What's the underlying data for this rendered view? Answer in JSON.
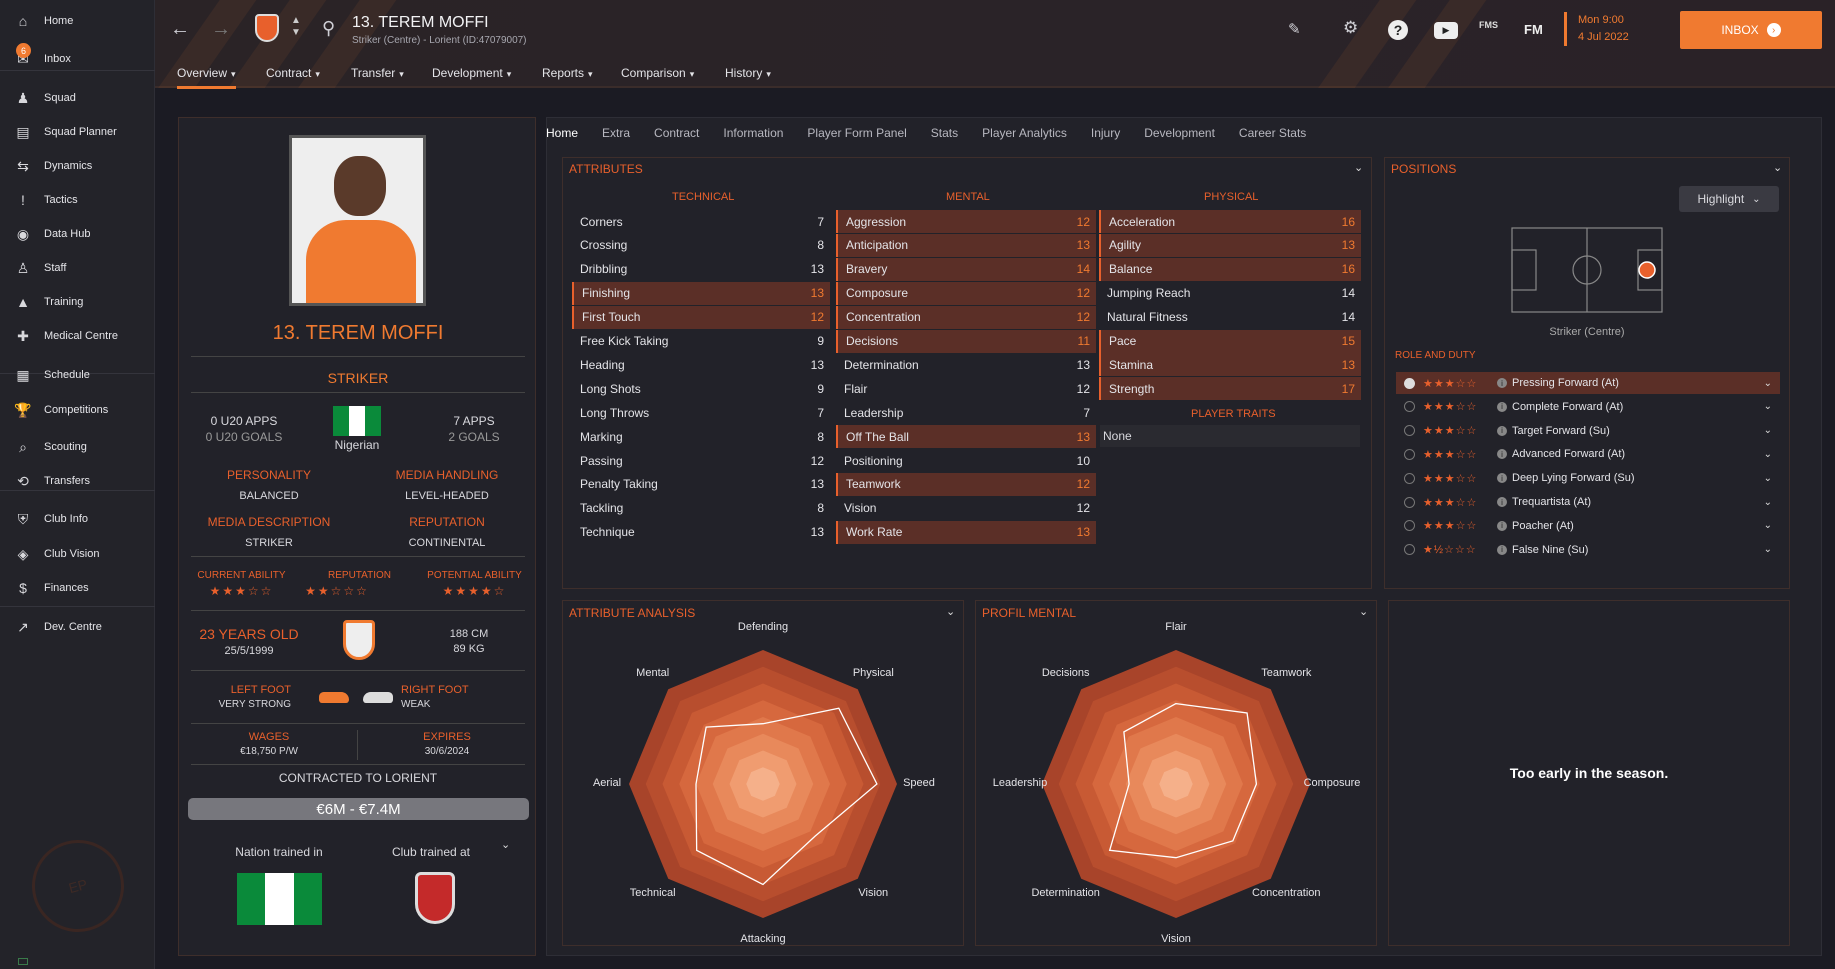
{
  "sidebar": {
    "items": [
      {
        "label": "Home",
        "icon": "home-icon"
      },
      {
        "label": "Inbox",
        "icon": "inbox-icon"
      },
      {
        "label": "Squad",
        "icon": "squad-icon"
      },
      {
        "label": "Squad Planner",
        "icon": "planner-icon"
      },
      {
        "label": "Dynamics",
        "icon": "dynamics-icon"
      },
      {
        "label": "Tactics",
        "icon": "tactics-icon"
      },
      {
        "label": "Data Hub",
        "icon": "datahub-icon"
      },
      {
        "label": "Staff",
        "icon": "staff-icon"
      },
      {
        "label": "Training",
        "icon": "training-icon"
      },
      {
        "label": "Medical Centre",
        "icon": "medical-icon"
      },
      {
        "label": "Schedule",
        "icon": "schedule-icon"
      },
      {
        "label": "Competitions",
        "icon": "trophy-icon"
      },
      {
        "label": "Scouting",
        "icon": "scouting-icon"
      },
      {
        "label": "Transfers",
        "icon": "transfers-icon"
      },
      {
        "label": "Club Info",
        "icon": "club-info-icon"
      },
      {
        "label": "Club Vision",
        "icon": "club-vision-icon"
      },
      {
        "label": "Finances",
        "icon": "finances-icon"
      },
      {
        "label": "Dev. Centre",
        "icon": "dev-centre-icon"
      }
    ],
    "inbox_badge": "6"
  },
  "header": {
    "title": "13. TEREM MOFFI",
    "subtitle": "Striker (Centre) - Lorient (ID:47079007)",
    "date_line1": "Mon 9:00",
    "date_line2": "4 Jul 2022",
    "inbox_label": "INBOX",
    "icon_fms": "FMS",
    "icon_fm": "FM"
  },
  "menu": [
    "Overview",
    "Contract",
    "Transfer",
    "Development",
    "Reports",
    "Comparison",
    "History"
  ],
  "profile": {
    "name": "13. TEREM MOFFI",
    "position": "STRIKER",
    "u20_apps": "0 U20 APPS",
    "u20_goals": "0 U20 GOALS",
    "nationality": "Nigerian",
    "apps": "7 APPS",
    "goals": "2 GOALS",
    "personality_label": "PERSONALITY",
    "personality": "BALANCED",
    "media_label": "MEDIA HANDLING",
    "media": "LEVEL-HEADED",
    "media_desc_label": "MEDIA DESCRIPTION",
    "media_desc": "STRIKER",
    "reputation_label": "REPUTATION",
    "reputation": "CONTINENTAL",
    "ca_label": "CURRENT ABILITY",
    "rep2_label": "REPUTATION",
    "pa_label": "POTENTIAL ABILITY",
    "ca_stars": "★★★☆☆",
    "rep_stars": "★★☆☆☆",
    "pa_stars": "★★★★☆",
    "age": "23 YEARS OLD",
    "dob": "25/5/1999",
    "height": "188 CM",
    "weight": "89 KG",
    "left_foot_label": "LEFT FOOT",
    "left_foot": "VERY STRONG",
    "right_foot_label": "RIGHT FOOT",
    "right_foot": "WEAK",
    "wages_label": "WAGES",
    "wages": "€18,750 P/W",
    "expires_label": "EXPIRES",
    "expires": "30/6/2024",
    "contracted": "CONTRACTED TO LORIENT",
    "value": "€6M - €7.4M",
    "nation_trained_label": "Nation trained in",
    "club_trained_label": "Club trained at"
  },
  "tabs": [
    "Home",
    "Extra",
    "Contract",
    "Information",
    "Player Form Panel",
    "Stats",
    "Player Analytics",
    "Injury",
    "Development",
    "Career Stats"
  ],
  "attributes": {
    "title": "ATTRIBUTES",
    "technical_label": "TECHNICAL",
    "mental_label": "MENTAL",
    "physical_label": "PHYSICAL",
    "technical": [
      [
        "Corners",
        "7",
        0
      ],
      [
        "Crossing",
        "8",
        0
      ],
      [
        "Dribbling",
        "13",
        0
      ],
      [
        "Finishing",
        "13",
        1
      ],
      [
        "First Touch",
        "12",
        1
      ],
      [
        "Free Kick Taking",
        "9",
        0
      ],
      [
        "Heading",
        "13",
        0
      ],
      [
        "Long Shots",
        "9",
        0
      ],
      [
        "Long Throws",
        "7",
        0
      ],
      [
        "Marking",
        "8",
        0
      ],
      [
        "Passing",
        "12",
        0
      ],
      [
        "Penalty Taking",
        "13",
        0
      ],
      [
        "Tackling",
        "8",
        0
      ],
      [
        "Technique",
        "13",
        0
      ]
    ],
    "mental": [
      [
        "Aggression",
        "12",
        1
      ],
      [
        "Anticipation",
        "13",
        1
      ],
      [
        "Bravery",
        "14",
        1
      ],
      [
        "Composure",
        "12",
        1
      ],
      [
        "Concentration",
        "12",
        1
      ],
      [
        "Decisions",
        "11",
        1
      ],
      [
        "Determination",
        "13",
        0
      ],
      [
        "Flair",
        "12",
        0
      ],
      [
        "Leadership",
        "7",
        0
      ],
      [
        "Off The Ball",
        "13",
        1
      ],
      [
        "Positioning",
        "10",
        0
      ],
      [
        "Teamwork",
        "12",
        1
      ],
      [
        "Vision",
        "12",
        0
      ],
      [
        "Work Rate",
        "13",
        1
      ]
    ],
    "physical": [
      [
        "Acceleration",
        "16",
        1
      ],
      [
        "Agility",
        "13",
        1
      ],
      [
        "Balance",
        "16",
        1
      ],
      [
        "Jumping Reach",
        "14",
        0
      ],
      [
        "Natural Fitness",
        "14",
        0
      ],
      [
        "Pace",
        "15",
        1
      ],
      [
        "Stamina",
        "13",
        1
      ],
      [
        "Strength",
        "17",
        1
      ]
    ],
    "traits_label": "PLAYER TRAITS",
    "traits": "None"
  },
  "positions": {
    "title": "POSITIONS",
    "highlight": "Highlight",
    "position_name": "Striker (Centre)",
    "role_label": "ROLE AND DUTY",
    "roles": [
      [
        "Pressing Forward (At)",
        "★★★☆☆"
      ],
      [
        "Complete Forward (At)",
        "★★★☆☆"
      ],
      [
        "Target Forward (Su)",
        "★★★☆☆"
      ],
      [
        "Advanced Forward (At)",
        "★★★☆☆"
      ],
      [
        "Deep Lying Forward (Su)",
        "★★★☆☆"
      ],
      [
        "Trequartista (At)",
        "★★★☆☆"
      ],
      [
        "Poacher (At)",
        "★★★☆☆"
      ],
      [
        "False Nine (Su)",
        "★½☆☆☆"
      ]
    ]
  },
  "analysis": {
    "title": "ATTRIBUTE ANALYSIS",
    "labels": [
      "Defending",
      "Physical",
      "Speed",
      "Vision",
      "Attacking",
      "Technical",
      "Aerial",
      "Mental"
    ],
    "values": [
      0.45,
      0.8,
      0.85,
      0.55,
      0.75,
      0.7,
      0.5,
      0.6
    ]
  },
  "mental_profile": {
    "title": "PROFIL MENTAL",
    "labels": [
      "Flair",
      "Teamwork",
      "Composure",
      "Concentration",
      "Vision",
      "Determination",
      "Leadership",
      "Decisions"
    ],
    "values": [
      0.6,
      0.75,
      0.6,
      0.6,
      0.55,
      0.7,
      0.35,
      0.55
    ]
  },
  "form": {
    "text": "Too early in the season."
  },
  "colors": {
    "accent": "#f07a30",
    "highlight_row": "#5b2f27"
  }
}
